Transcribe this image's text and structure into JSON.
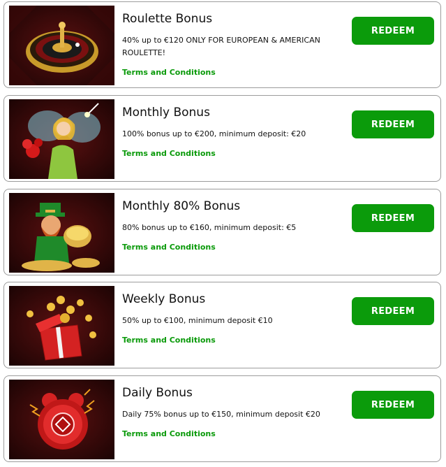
{
  "bonuses": [
    {
      "title": "Roulette Bonus",
      "description": "40% up to €120 ONLY FOR EUROPEAN & AMERICAN ROULETTE!",
      "terms_label": "Terms and Conditions",
      "redeem_label": "REDEEM",
      "image_icon": "roulette-wheel-icon"
    },
    {
      "title": "Monthly Bonus",
      "description": "100% bonus up to €200, minimum deposit: €20",
      "terms_label": "Terms and Conditions",
      "redeem_label": "REDEEM",
      "image_icon": "fairy-icon"
    },
    {
      "title": "Monthly 80% Bonus",
      "description": "80% bonus up to €160, minimum deposit: €5",
      "terms_label": "Terms and Conditions",
      "redeem_label": "REDEEM",
      "image_icon": "leprechaun-gold-icon"
    },
    {
      "title": "Weekly Bonus",
      "description": "50% up to €100, minimum deposit €10",
      "terms_label": "Terms and Conditions",
      "redeem_label": "REDEEM",
      "image_icon": "gift-box-coins-icon"
    },
    {
      "title": "Daily Bonus",
      "description": "Daily 75% bonus up to €150, minimum deposit €20",
      "terms_label": "Terms and Conditions",
      "redeem_label": "REDEEM",
      "image_icon": "alarm-clock-icon"
    }
  ],
  "colors": {
    "accent_green": "#0b9b0b",
    "terms_green": "#0a9a0a",
    "card_border": "#9c9c9c",
    "image_background": "#2a0707"
  }
}
